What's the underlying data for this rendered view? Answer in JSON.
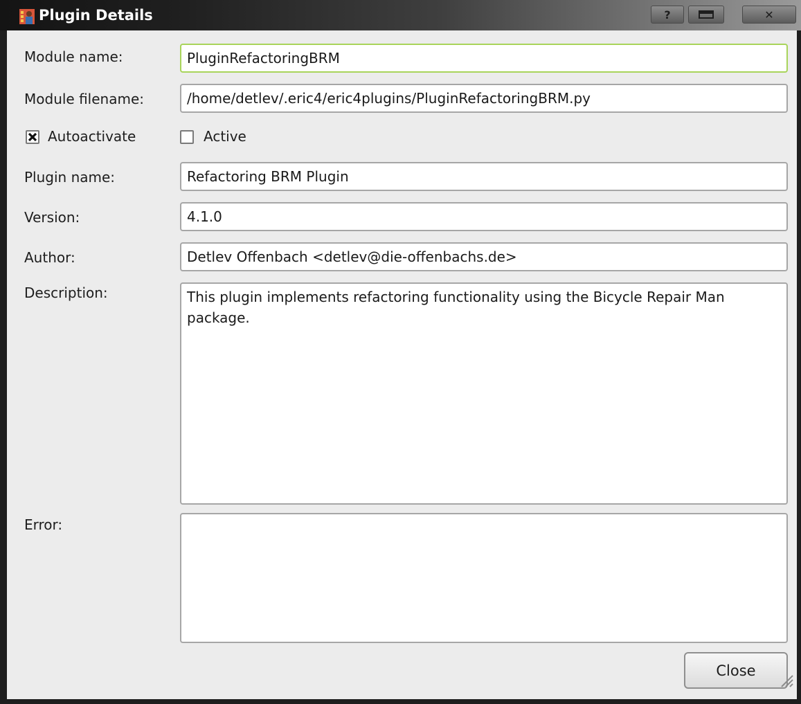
{
  "window": {
    "title": "Plugin Details",
    "buttons": {
      "help": "?",
      "close": "✕"
    }
  },
  "form": {
    "module_name": {
      "label": "Module name:",
      "value": "PluginRefactoringBRM"
    },
    "module_filename": {
      "label": "Module filename:",
      "value": "/home/detlev/.eric4/eric4plugins/PluginRefactoringBRM.py"
    },
    "autoactivate": {
      "label": "Autoactivate",
      "checked": true
    },
    "active": {
      "label": "Active",
      "checked": false
    },
    "plugin_name": {
      "label": "Plugin name:",
      "value": "Refactoring BRM Plugin"
    },
    "version": {
      "label": "Version:",
      "value": "4.1.0"
    },
    "author": {
      "label": "Author:",
      "value": "Detlev Offenbach <detlev@die-offenbachs.de>"
    },
    "description": {
      "label": "Description:",
      "value": "This plugin implements refactoring functionality using the Bicycle Repair Man package."
    },
    "error": {
      "label": "Error:",
      "value": ""
    }
  },
  "footer": {
    "close_label": "Close"
  },
  "colors": {
    "focus_border": "#a8d45a",
    "field_border": "#a6a6a6",
    "dialog_bg": "#ececec"
  }
}
